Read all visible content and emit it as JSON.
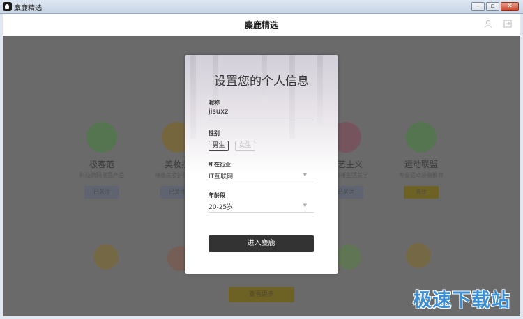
{
  "window": {
    "title": "麋鹿精选",
    "minimize_glyph": "–",
    "restore_glyph": "▫",
    "close_glyph": "✕"
  },
  "header": {
    "brand": "麋鹿精选",
    "user_icon": "user-icon",
    "exit_icon": "logout-icon"
  },
  "background": {
    "categories": [
      {
        "name": "极客范",
        "sub": "科技数码创意产品",
        "button": "已关注"
      },
      {
        "name": "美妆控",
        "sub": "精选美妆护肤好物",
        "button": "已关注"
      },
      {
        "name": "文艺主义",
        "sub": "文艺清新生活美学",
        "button": "已关注"
      },
      {
        "name": "运动联盟",
        "sub": "专业运动装备推荐",
        "button": "关注"
      }
    ],
    "more_button": "查看更多"
  },
  "modal": {
    "title": "设置您的个人信息",
    "nickname": {
      "label": "昵称",
      "value": "jisuxz"
    },
    "gender": {
      "label": "性别",
      "options": [
        "男生",
        "女生"
      ],
      "selected": "男生"
    },
    "industry": {
      "label": "所在行业",
      "value": "IT互联网"
    },
    "age": {
      "label": "年龄段",
      "value": "20-25岁"
    },
    "submit": "进入麋鹿"
  },
  "watermark": "极速下载站",
  "colors": {
    "accent_yellow": "#f3c31a",
    "submit_bg": "#333333",
    "watermark": "#3a8fd6"
  }
}
